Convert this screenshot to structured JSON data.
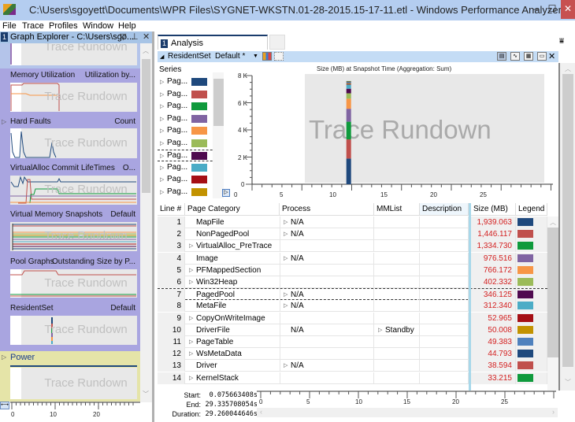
{
  "window": {
    "title": "C:\\Users\\sgoyett\\Documents\\WPR Files\\SYGNET-WKSTN.01-28-2015.15-17-11.etl - Windows Performance Analyzer",
    "minimize": "–",
    "maximize": "☐",
    "close": "✕"
  },
  "menu": [
    "File",
    "Trace",
    "Profiles",
    "Window",
    "Help"
  ],
  "graph_explorer": {
    "number": "1",
    "title": "Graph Explorer - C:\\Users\\sgo...",
    "icons": [
      "dropdown-icon",
      "pin-icon",
      "close-icon"
    ],
    "watermark": "Trace Rundown",
    "sections": [
      {
        "title": "Memory Utilization",
        "preset": "Utilization by..."
      },
      {
        "title": "Hard Faults",
        "preset": "Count",
        "expandable": true
      },
      {
        "title": "VirtualAlloc Commit LifeTimes",
        "preset": "O..."
      },
      {
        "title": "Virtual Memory Snapshots",
        "preset": "Default"
      },
      {
        "title": "Pool Graphs",
        "preset": "Outstanding Size by P..."
      },
      {
        "title": "ResidentSet",
        "preset": "Default"
      },
      {
        "title": "Power",
        "preset": "",
        "expandable": true
      }
    ],
    "axis_ticks": [
      "0",
      "10",
      "20"
    ]
  },
  "analysis": {
    "tab_number": "1",
    "tab_label": "Analysis",
    "table_name": "ResidentSet",
    "preset": "Default *",
    "series_header": "Series",
    "series": [
      {
        "label": "Pag...",
        "color": "#1f497d"
      },
      {
        "label": "Pag...",
        "color": "#c0504d"
      },
      {
        "label": "Pag...",
        "color": "#0f9a3c"
      },
      {
        "label": "Pag...",
        "color": "#8064a2"
      },
      {
        "label": "Pag...",
        "color": "#f79646"
      },
      {
        "label": "Pag...",
        "color": "#9bbb59"
      },
      {
        "label": "Pag...",
        "color": "#4f0a4f"
      },
      {
        "label": "Pag...",
        "color": "#4bacc6"
      },
      {
        "label": "Pag...",
        "color": "#a50f15"
      },
      {
        "label": "Pag...",
        "color": "#c29200"
      }
    ],
    "chart_title": "Size (MB) at Snapshot Time (Aggregation: Sum)",
    "watermark": "Trace Rundown",
    "y_ticks": [
      "8 K",
      "6 K",
      "4 K",
      "2 K",
      "0"
    ],
    "x_ticks": [
      "0",
      "5",
      "10",
      "15",
      "20",
      "25"
    ]
  },
  "table": {
    "columns": [
      "Line #",
      "Page Category",
      "Process",
      "MMList",
      "Description",
      "Size (MB)",
      "Legend"
    ],
    "rows": [
      {
        "line": "1",
        "category": "MapFile",
        "cat_expand": false,
        "process": "N/A",
        "proc_expand": true,
        "mmlist": "",
        "size": "1,939.063",
        "color": "#1f497d"
      },
      {
        "line": "2",
        "category": "NonPagedPool",
        "cat_expand": false,
        "process": "N/A",
        "proc_expand": true,
        "mmlist": "",
        "size": "1,446.117",
        "color": "#c0504d"
      },
      {
        "line": "3",
        "category": "VirtualAlloc_PreTrace",
        "cat_expand": true,
        "process": "",
        "proc_expand": false,
        "mmlist": "",
        "size": "1,334.730",
        "color": "#0f9a3c"
      },
      {
        "line": "4",
        "category": "Image",
        "cat_expand": false,
        "process": "N/A",
        "proc_expand": true,
        "mmlist": "",
        "size": "976.516",
        "color": "#8064a2"
      },
      {
        "line": "5",
        "category": "PFMappedSection",
        "cat_expand": true,
        "process": "",
        "proc_expand": false,
        "mmlist": "",
        "size": "766.172",
        "color": "#f79646"
      },
      {
        "line": "6",
        "category": "Win32Heap",
        "cat_expand": true,
        "process": "",
        "proc_expand": false,
        "mmlist": "",
        "size": "402.332",
        "color": "#9bbb59"
      },
      {
        "line": "7",
        "category": "PagedPool",
        "cat_expand": false,
        "process": "N/A",
        "proc_expand": true,
        "mmlist": "",
        "size": "346.125",
        "color": "#4f0a4f",
        "selected": true
      },
      {
        "line": "8",
        "category": "MetaFile",
        "cat_expand": false,
        "process": "N/A",
        "proc_expand": true,
        "mmlist": "",
        "size": "312.340",
        "color": "#4bacc6"
      },
      {
        "line": "9",
        "category": "CopyOnWriteImage",
        "cat_expand": true,
        "process": "",
        "proc_expand": false,
        "mmlist": "",
        "size": "52.965",
        "color": "#a50f15"
      },
      {
        "line": "10",
        "category": "DriverFile",
        "cat_expand": false,
        "process": "N/A",
        "proc_expand": false,
        "mmlist": "Standby",
        "size": "50.008",
        "color": "#c29200"
      },
      {
        "line": "11",
        "category": "PageTable",
        "cat_expand": true,
        "process": "",
        "proc_expand": false,
        "mmlist": "",
        "size": "49.383",
        "color": "#4f81bd"
      },
      {
        "line": "12",
        "category": "WsMetaData",
        "cat_expand": true,
        "process": "",
        "proc_expand": false,
        "mmlist": "",
        "size": "44.793",
        "color": "#1f497d"
      },
      {
        "line": "13",
        "category": "Driver",
        "cat_expand": false,
        "process": "N/A",
        "proc_expand": true,
        "mmlist": "",
        "size": "38.594",
        "color": "#c0504d"
      },
      {
        "line": "14",
        "category": "KernelStack",
        "cat_expand": true,
        "process": "",
        "proc_expand": false,
        "mmlist": "",
        "size": "33.215",
        "color": "#0f9a3c"
      }
    ]
  },
  "time_info": {
    "start_label": "Start:",
    "start": "0.075663408s",
    "end_label": "End:",
    "end": "29.335708054s",
    "duration_label": "Duration:",
    "duration": "29.260044646s"
  },
  "bottom_axis_ticks": [
    "0",
    "5",
    "10",
    "15",
    "20",
    "25"
  ]
}
